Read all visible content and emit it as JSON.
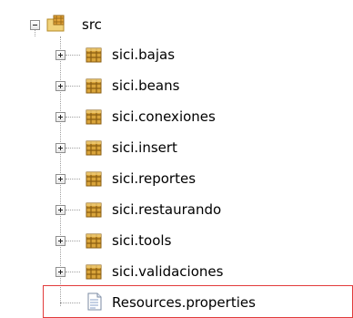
{
  "tree": {
    "root": {
      "label": "src",
      "icon": "source-folder-icon",
      "expanded": true
    },
    "packages": [
      {
        "label": "sici.bajas",
        "icon": "package-icon"
      },
      {
        "label": "sici.beans",
        "icon": "package-icon"
      },
      {
        "label": "sici.conexiones",
        "icon": "package-icon"
      },
      {
        "label": "sici.insert",
        "icon": "package-icon"
      },
      {
        "label": "sici.reportes",
        "icon": "package-icon"
      },
      {
        "label": "sici.restaurando",
        "icon": "package-icon"
      },
      {
        "label": "sici.tools",
        "icon": "package-icon"
      },
      {
        "label": "sici.validaciones",
        "icon": "package-icon"
      }
    ],
    "file": {
      "label": "Resources.properties",
      "icon": "properties-file-icon",
      "highlighted": true
    }
  },
  "colors": {
    "highlight_border": "#e23b3b",
    "package_icon": "#d9a43a"
  }
}
